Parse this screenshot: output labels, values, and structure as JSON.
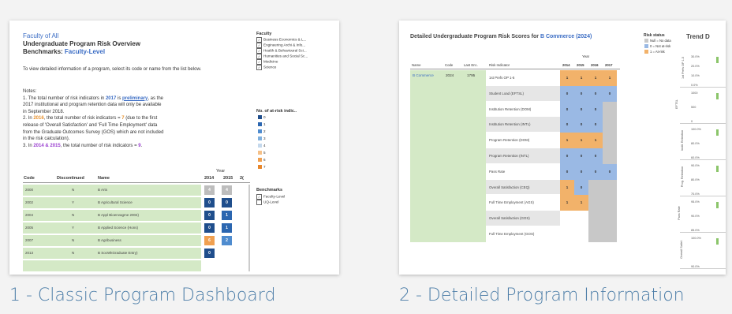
{
  "cards": [
    {
      "caption": "1 - Classic Program Dashboard",
      "header": {
        "line1": "Faculty of All",
        "line2": "Undergraduate Program Risk Overview",
        "line3_prefix": "Benchmarks: ",
        "line3_link": "Faculty-Level",
        "instructions": "To view detailed information of a program, select its code or name from the list below."
      },
      "notes": {
        "title": "Notes:",
        "n1a": "1. The total number of risk indicators in ",
        "n1_year": "2017",
        "n1b": " is ",
        "n1_link": "preliminary",
        "n1c": ", as the",
        "n1d": "2017 institutional and program retention data will only be available",
        "n1e": "in September 2018.",
        "n2a": "2. In ",
        "n2_year": "2016",
        "n2b": ", the total number of risk indicators = ",
        "n2_num": "7",
        "n2c": " (due to the first",
        "n2d": "release of 'Overall Satisfaction' and 'Full Time Employment' data",
        "n2e": "from the Graduate Outcomes Survey (GOS) which are not included",
        "n2f": "in the risk calculation).",
        "n3a": "3. In ",
        "n3_years": "2014 & 2015",
        "n3b": ", the total number of risk indicators = ",
        "n3_num": "9",
        "n3c": "."
      },
      "faculty_filter": {
        "title": "Faculty",
        "items": [
          "Business Economics & L...",
          "Engineering Archi & Info...",
          "Health & Behavioural Sci...",
          "Humanities and Social Sc...",
          "Medicine",
          "Science"
        ]
      },
      "risk_legend": {
        "title": "No. of at-risk indic..",
        "items": [
          "0",
          "1",
          "2",
          "3",
          "4",
          "5",
          "6",
          "7"
        ],
        "colors": [
          "#1f4e8c",
          "#2b66b0",
          "#4f8ccf",
          "#7fb0de",
          "#c4d8ec",
          "#f5c088",
          "#f0a050",
          "#e8862a"
        ]
      },
      "benchmarks": {
        "title": "Benchmarks",
        "items": [
          {
            "label": "Faculty-Level",
            "checked": true
          },
          {
            "label": "UQ-Level",
            "checked": false
          }
        ]
      },
      "table": {
        "year_label": "Year",
        "headers": [
          "Code",
          "Discontinued",
          "Name"
        ],
        "years": [
          "2014",
          "2015",
          "2("
        ],
        "rows": [
          {
            "code": "2000",
            "disc": "N",
            "name": "B Arts",
            "vals": [
              "4",
              "4"
            ],
            "colors": [
              "#bdbdbd",
              "#bdbdbd"
            ]
          },
          {
            "code": "2002",
            "disc": "Y",
            "name": "B Agricultural Science",
            "vals": [
              "0",
              "0"
            ],
            "colors": [
              "#1f4e8c",
              "#1f4e8c"
            ]
          },
          {
            "code": "2004",
            "disc": "N",
            "name": "B Appl Bioenvagme 2004)",
            "vals": [
              "0",
              "1"
            ],
            "colors": [
              "#1f4e8c",
              "#2b66b0"
            ]
          },
          {
            "code": "2005",
            "disc": "Y",
            "name": "B Applied Science (Hons)",
            "vals": [
              "0",
              "1"
            ],
            "colors": [
              "#1f4e8c",
              "#2b66b0"
            ]
          },
          {
            "code": "2007",
            "disc": "N",
            "name": "B Agribusiness",
            "vals": [
              "6",
              "2"
            ],
            "colors": [
              "#f0a050",
              "#4f8ccf"
            ]
          },
          {
            "code": "2013",
            "disc": "N",
            "name": "B SocWkGraduate Entry)",
            "vals": [
              "0",
              ""
            ],
            "colors": [
              "#1f4e8c",
              ""
            ]
          },
          {
            "code": "",
            "disc": "",
            "name": "",
            "vals": [
              "",
              ""
            ],
            "colors": [
              "",
              ""
            ]
          }
        ]
      }
    },
    {
      "caption": "2 - Detailed Program Information",
      "title_prefix": "Detailed Undergraduate Program Risk Scores for ",
      "title_program": "B Commerce (2024)",
      "trend_title": "Trend D",
      "risk_status": {
        "title": "Risk status",
        "items": [
          {
            "label": "Null = No data",
            "color": "#c8c8c8"
          },
          {
            "label": "0 = Not at-risk",
            "color": "#9ab9e4"
          },
          {
            "label": "1 = At-risk",
            "color": "#f2b26a"
          }
        ]
      },
      "table": {
        "year_label": "Year",
        "headers": [
          "Name",
          "Code",
          "Last Enr..",
          "Risk Indicator"
        ],
        "years": [
          "2014",
          "2015",
          "2016",
          "2017"
        ],
        "program": "B Commerce",
        "code": "2024",
        "last_enr": "1795",
        "rows": [
          {
            "indicator": "1st Prefs OP 1-5",
            "vals": [
              "1",
              "1",
              "1",
              "1"
            ],
            "colors": [
              "#f2b26a",
              "#f2b26a",
              "#f2b26a",
              "#f2b26a"
            ]
          },
          {
            "indicator": "Student Load (EFTSL)",
            "vals": [
              "0",
              "0",
              "0",
              "0"
            ],
            "colors": [
              "#9ab9e4",
              "#9ab9e4",
              "#9ab9e4",
              "#9ab9e4"
            ]
          },
          {
            "indicator": "Institution Retention (DOM)",
            "vals": [
              "0",
              "0",
              "0",
              ""
            ],
            "colors": [
              "#9ab9e4",
              "#9ab9e4",
              "#9ab9e4",
              "#c8c8c8"
            ]
          },
          {
            "indicator": "Institution Retention (INTL)",
            "vals": [
              "0",
              "0",
              "0",
              ""
            ],
            "colors": [
              "#9ab9e4",
              "#9ab9e4",
              "#9ab9e4",
              "#c8c8c8"
            ]
          },
          {
            "indicator": "Program Retention (DOM)",
            "vals": [
              "1",
              "1",
              "1",
              ""
            ],
            "colors": [
              "#f2b26a",
              "#f2b26a",
              "#f2b26a",
              "#c8c8c8"
            ]
          },
          {
            "indicator": "Program Retention (INTL)",
            "vals": [
              "0",
              "0",
              "0",
              ""
            ],
            "colors": [
              "#9ab9e4",
              "#9ab9e4",
              "#9ab9e4",
              "#c8c8c8"
            ]
          },
          {
            "indicator": "Pass Rate",
            "vals": [
              "0",
              "0",
              "0",
              "0"
            ],
            "colors": [
              "#9ab9e4",
              "#9ab9e4",
              "#9ab9e4",
              "#9ab9e4"
            ]
          },
          {
            "indicator": "Overall Satisfaction (CEQ)",
            "vals": [
              "1",
              "0",
              "",
              ""
            ],
            "colors": [
              "#f2b26a",
              "#9ab9e4",
              "#c8c8c8",
              "#c8c8c8"
            ]
          },
          {
            "indicator": "Full Time Employment (AGS)",
            "vals": [
              "1",
              "1",
              "",
              ""
            ],
            "colors": [
              "#f2b26a",
              "#f2b26a",
              "#c8c8c8",
              "#c8c8c8"
            ]
          },
          {
            "indicator": "Overall Satisfaction (GOS)",
            "vals": [
              "",
              "",
              "",
              ""
            ],
            "colors": [
              "#ffffff",
              "#ffffff",
              "#c8c8c8",
              "#c8c8c8"
            ]
          },
          {
            "indicator": "Full Time Employment (GOS)",
            "vals": [
              "",
              "",
              "",
              ""
            ],
            "colors": [
              "#ffffff",
              "#ffffff",
              "#c8c8c8",
              "#c8c8c8"
            ]
          }
        ]
      },
      "trend_axes": [
        {
          "label": "1st Prefs OP 1-5",
          "ticks": [
            "30.0%",
            "20.0%",
            "10.0%",
            "0.0%"
          ]
        },
        {
          "label": "EFTSL",
          "ticks": [
            "1000",
            "500",
            "0"
          ]
        },
        {
          "label": "Instit. Retention",
          "ticks": [
            "100.0%",
            "80.0%",
            "60.0%"
          ]
        },
        {
          "label": "Prog. Retention",
          "ticks": [
            "90.0%",
            "80.0%",
            "70.0%"
          ]
        },
        {
          "label": "Pass Rate",
          "ticks": [
            "95.0%",
            "90.0%",
            "85.0%"
          ]
        },
        {
          "label": "Overall Satisf.",
          "ticks": [
            "100.0%",
            "90.0%"
          ]
        }
      ]
    }
  ]
}
